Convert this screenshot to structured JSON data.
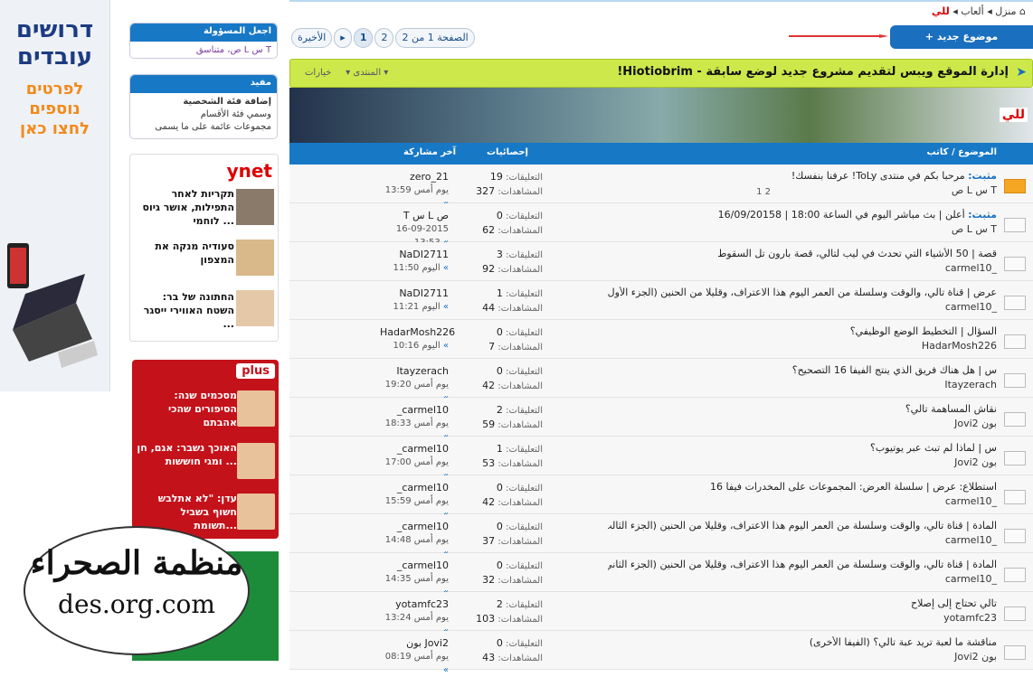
{
  "ad_left": {
    "line1": "דרושים",
    "line2": "עובדים",
    "line3": "לפרטים",
    "line4": "נוספים",
    "line5": "לחצו כאן"
  },
  "sidebar": {
    "box1": {
      "title": "اجعل المسؤولة",
      "body": "ص، متناسق L س T"
    },
    "box2": {
      "title": "مفيد",
      "items": [
        "إضافة فئة الشخصية",
        "وسمي فئة الأقسام",
        "مجموعات عائمة على ما يسمى"
      ]
    }
  },
  "ynet": {
    "logo": "ynet",
    "items": [
      "תקריות לאחר התפילות, אושר גיוס לוחמי ...",
      "סעודיה מנקה את המצפון",
      "החתונה של בר: השטח האווירי ייסגר ..."
    ]
  },
  "pplus": {
    "logo": "plus",
    "items": [
      "מסכמים שנה: הסיפורים שהכי אהבתם",
      "האוכך נשבר: אגם, חן ומגי חוששות ...",
      "עדן: \"לא אתלבש חשוף בשביל תשומת..."
    ]
  },
  "watermark": {
    "arabic": "منظمة الصحراء",
    "url": "des.org.com"
  },
  "breadcrumb": {
    "home": "منزل",
    "games": "ألعاب",
    "current": "للي"
  },
  "new_topic": "+ موضوع جديد",
  "pager": {
    "last": "الأخيرة",
    "page_info": "الصفحة 1 من 2",
    "pages": [
      "1",
      "2"
    ]
  },
  "forum": {
    "title": "إدارة الموقع ويبس لتقديم مشروع جديد لوضع سابقة - Hiotiobrim!",
    "options": "خيارات",
    "forum_label": "المنتدى",
    "banner_tag": "للي"
  },
  "columns": {
    "topic": "الموضوع / كاتب",
    "stats": "إحصائيات",
    "last": "آخر مشاركة"
  },
  "stats_labels": {
    "replies": "التعليقات:",
    "views": "المشاهدات:"
  },
  "threads": [
    {
      "title": "مرحبا بكم في منتدى ToLy! عرفنا بنفسك!",
      "sticky": "مثبت:",
      "author": "T س L ص",
      "pages": "1 2",
      "replies": "19",
      "views": "327",
      "last_user": "zero_21",
      "last_date": "يوم أمس 13:59",
      "hot": true
    },
    {
      "title": "أعلن | بث مباشر اليوم في الساعة 18:00 | 16/09/20158",
      "sticky": "مثبت:",
      "author": "T س L ص",
      "replies": "0",
      "views": "62",
      "last_user": "T س L ص",
      "last_date": "16-09-2015 13:53"
    },
    {
      "title": "قصة | 50 الأشياء التي تحدث في ليب لتالي، قصة بارون تل السقوط",
      "author": "_carmel10",
      "replies": "3",
      "views": "92",
      "last_user": "NaDI2711",
      "last_date": "اليوم 11:50"
    },
    {
      "title": "عرض | قناة تالي، والوقت وسلسلة من العمر اليوم هذا الاعتراف، وقليلا من الحنين (الجزء الأول)",
      "author": "_carmel10",
      "replies": "1",
      "views": "44",
      "last_user": "NaDI2711",
      "last_date": "اليوم 11:21"
    },
    {
      "title": "السؤال | التخطيط الوضع الوظيفي؟",
      "author": "HadarMosh226",
      "replies": "0",
      "views": "7",
      "last_user": "HadarMosh226",
      "last_date": "اليوم 10:16"
    },
    {
      "title": "س | هل هناك فريق الذي ينتج الفيفا 16 التصحيح؟",
      "author": "Itayzerach",
      "replies": "0",
      "views": "42",
      "last_user": "Itayzerach",
      "last_date": "يوم أمس 19:20"
    },
    {
      "title": "نقاش المساهمة تالي؟",
      "author": "بون Jovi2",
      "replies": "2",
      "views": "59",
      "last_user": "_carmel10",
      "last_date": "يوم أمس 18:33"
    },
    {
      "title": "س | لماذا لم تبث عبر يوتيوب؟",
      "author": "بون Jovi2",
      "replies": "1",
      "views": "53",
      "last_user": "_carmel10",
      "last_date": "يوم أمس 17:00"
    },
    {
      "title": "استطلاع: عرض | سلسلة العرض: المجموعات على المخدرات فيفا 16",
      "author": "_carmel10",
      "replies": "0",
      "views": "42",
      "last_user": "_carmel10",
      "last_date": "يوم أمس 15:59"
    },
    {
      "title": "المادة | قناة تالي، والوقت وسلسلة من العمر اليوم هذا الاعتراف، وقليلا من الحنين (الجزء الثالث)",
      "author": "_carmel10",
      "replies": "0",
      "views": "37",
      "last_user": "_carmel10",
      "last_date": "يوم أمس 14:48"
    },
    {
      "title": "المادة | قناة تالي، والوقت وسلسلة من العمر اليوم هذا الاعتراف، وقليلا من الحنين (الجزء الثاني)",
      "author": "_carmel10",
      "replies": "0",
      "views": "32",
      "last_user": "_carmel10",
      "last_date": "يوم أمس 14:35"
    },
    {
      "title": "تالي تحتاج إلى إصلاح",
      "author": "yotamfc23",
      "replies": "2",
      "views": "103",
      "last_user": "yotamfc23",
      "last_date": "يوم أمس 13:24"
    },
    {
      "title": "مناقشة ما لعبة تريد عبة تالي؟ (الفيفا الأخرى)",
      "author": "بون Jovi2",
      "replies": "0",
      "views": "43",
      "last_user": "بون Jovi2",
      "last_date": "يوم أمس 08:19"
    }
  ],
  "colors": {
    "header_blue": "#1778c6",
    "forum_bar": "#cde84a",
    "ynet_red": "#d00",
    "pplus_red": "#c4121a"
  }
}
